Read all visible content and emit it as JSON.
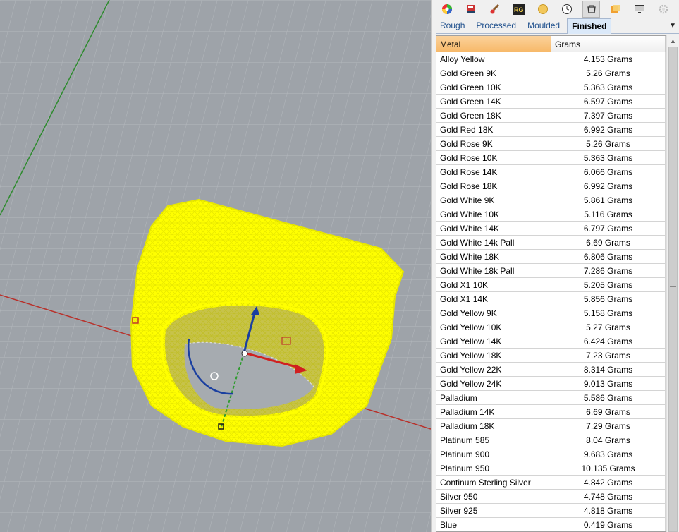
{
  "toolbar": {
    "icons": [
      {
        "name": "color-wheel-icon"
      },
      {
        "name": "book-icon"
      },
      {
        "name": "brush-icon"
      },
      {
        "name": "rg-logo-icon",
        "text": "RG"
      },
      {
        "name": "gem-icon"
      },
      {
        "name": "clock-icon"
      },
      {
        "name": "ring-icon"
      },
      {
        "name": "layers-icon"
      },
      {
        "name": "monitor-icon"
      },
      {
        "name": "gear-icon"
      }
    ]
  },
  "tabs": [
    {
      "label": "Rough",
      "active": false
    },
    {
      "label": "Processed",
      "active": false
    },
    {
      "label": "Moulded",
      "active": false
    },
    {
      "label": "Finished",
      "active": true
    }
  ],
  "table": {
    "headers": {
      "metal": "Metal",
      "grams": "Grams"
    },
    "rows": [
      {
        "metal": "Alloy Yellow",
        "grams": "4.153 Grams"
      },
      {
        "metal": "Gold Green 9K",
        "grams": "5.26 Grams"
      },
      {
        "metal": "Gold Green 10K",
        "grams": "5.363 Grams"
      },
      {
        "metal": "Gold Green 14K",
        "grams": "6.597 Grams"
      },
      {
        "metal": "Gold Green 18K",
        "grams": "7.397 Grams"
      },
      {
        "metal": "Gold Red 18K",
        "grams": "6.992 Grams"
      },
      {
        "metal": "Gold Rose 9K",
        "grams": "5.26 Grams"
      },
      {
        "metal": "Gold Rose 10K",
        "grams": "5.363 Grams"
      },
      {
        "metal": "Gold Rose 14K",
        "grams": "6.066 Grams"
      },
      {
        "metal": "Gold Rose 18K",
        "grams": "6.992 Grams"
      },
      {
        "metal": "Gold White 9K",
        "grams": "5.861 Grams"
      },
      {
        "metal": "Gold White 10K",
        "grams": "5.116 Grams"
      },
      {
        "metal": "Gold White 14K",
        "grams": "6.797 Grams"
      },
      {
        "metal": "Gold White 14k Pall",
        "grams": "6.69 Grams"
      },
      {
        "metal": "Gold White 18K",
        "grams": "6.806 Grams"
      },
      {
        "metal": "Gold White 18k Pall",
        "grams": "7.286 Grams"
      },
      {
        "metal": "Gold X1 10K",
        "grams": "5.205 Grams"
      },
      {
        "metal": "Gold X1 14K",
        "grams": "5.856 Grams"
      },
      {
        "metal": "Gold Yellow 9K",
        "grams": "5.158 Grams"
      },
      {
        "metal": "Gold Yellow 10K",
        "grams": "5.27 Grams"
      },
      {
        "metal": "Gold Yellow 14K",
        "grams": "6.424 Grams"
      },
      {
        "metal": "Gold Yellow 18K",
        "grams": "7.23 Grams"
      },
      {
        "metal": "Gold Yellow 22K",
        "grams": "8.314 Grams"
      },
      {
        "metal": "Gold Yellow 24K",
        "grams": "9.013 Grams"
      },
      {
        "metal": "Palladium",
        "grams": "5.586 Grams"
      },
      {
        "metal": "Palladium 14K",
        "grams": "6.69 Grams"
      },
      {
        "metal": "Palladium 18K",
        "grams": "7.29 Grams"
      },
      {
        "metal": "Platinum 585",
        "grams": "8.04 Grams"
      },
      {
        "metal": "Platinum 900",
        "grams": "9.683 Grams"
      },
      {
        "metal": "Platinum 950",
        "grams": "10.135 Grams"
      },
      {
        "metal": "Continum Sterling Silver",
        "grams": "4.842 Grams"
      },
      {
        "metal": "Silver 950",
        "grams": "4.748 Grams"
      },
      {
        "metal": "Silver 925",
        "grams": "4.818 Grams"
      },
      {
        "metal": "Blue",
        "grams": "0.419 Grams"
      }
    ]
  },
  "colors": {
    "viewport_bg": "#9ea3a9",
    "model_wire": "#ffff00",
    "x_axis": "#c0392b",
    "y_axis": "#2e8b2e",
    "header_highlight": "#f7b96a",
    "active_tab": "#dbe9f9"
  }
}
